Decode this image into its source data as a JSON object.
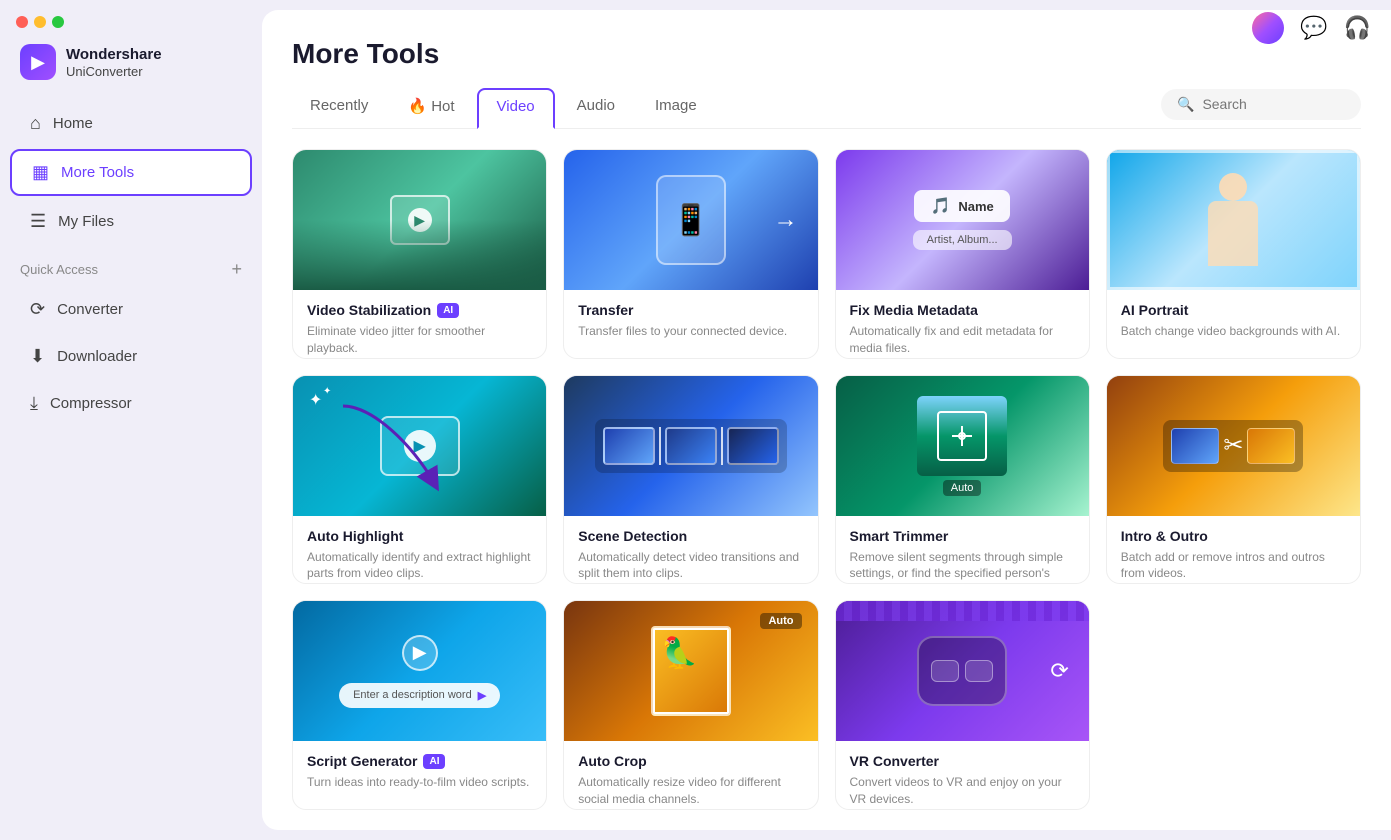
{
  "app": {
    "name": "Wondershare",
    "product": "UniConverter"
  },
  "windowControls": {
    "close": "close",
    "minimize": "minimize",
    "maximize": "maximize"
  },
  "sidebar": {
    "nav": [
      {
        "id": "home",
        "label": "Home",
        "icon": "⌂"
      },
      {
        "id": "more-tools",
        "label": "More Tools",
        "icon": "▦",
        "active": true
      },
      {
        "id": "my-files",
        "label": "My Files",
        "icon": "☰"
      }
    ],
    "quickAccess": {
      "label": "Quick Access",
      "items": [
        {
          "id": "converter",
          "label": "Converter",
          "icon": "⟳"
        },
        {
          "id": "downloader",
          "label": "Downloader",
          "icon": "⬇"
        },
        {
          "id": "compressor",
          "label": "Compressor",
          "icon": "⤓"
        }
      ]
    }
  },
  "header": {
    "title": "More Tools",
    "tabs": [
      {
        "id": "recently",
        "label": "Recently"
      },
      {
        "id": "hot",
        "label": "🔥 Hot"
      },
      {
        "id": "video",
        "label": "Video",
        "active": true
      },
      {
        "id": "audio",
        "label": "Audio"
      },
      {
        "id": "image",
        "label": "Image"
      }
    ],
    "search": {
      "placeholder": "Search"
    }
  },
  "tools": [
    {
      "id": "video-stabilization",
      "title": "Video Stabilization",
      "hasAI": true,
      "desc": "Eliminate video jitter for smoother playback.",
      "imgType": "stabilization"
    },
    {
      "id": "transfer",
      "title": "Transfer",
      "hasAI": false,
      "desc": "Transfer files to your connected device.",
      "imgType": "transfer"
    },
    {
      "id": "fix-media-metadata",
      "title": "Fix Media Metadata",
      "hasAI": false,
      "desc": "Automatically fix and edit metadata for media files.",
      "imgType": "metadata"
    },
    {
      "id": "ai-portrait",
      "title": "AI Portrait",
      "hasAI": false,
      "desc": "Batch change video backgrounds with AI.",
      "imgType": "portrait"
    },
    {
      "id": "auto-highlight",
      "title": "Auto Highlight",
      "hasAI": false,
      "desc": "Automatically identify and extract highlight parts from video clips.",
      "imgType": "autohighlight"
    },
    {
      "id": "scene-detection",
      "title": "Scene Detection",
      "hasAI": false,
      "desc": "Automatically detect video transitions and split them into clips.",
      "imgType": "scene"
    },
    {
      "id": "smart-trimmer",
      "title": "Smart Trimmer",
      "hasAI": false,
      "desc": "Remove silent segments through simple settings, or find the specified person's clips in the video.",
      "imgType": "trimmer"
    },
    {
      "id": "intro-outro",
      "title": "Intro & Outro",
      "hasAI": false,
      "desc": "Batch add or remove intros and outros from videos.",
      "imgType": "intro"
    },
    {
      "id": "script-generator",
      "title": "Script Generator",
      "hasAI": true,
      "desc": "Turn ideas into ready-to-film video scripts.",
      "imgType": "script",
      "placeholder": "Enter a description word"
    },
    {
      "id": "auto-crop",
      "title": "Auto Crop",
      "hasAI": false,
      "desc": "Automatically resize video for different social media channels.",
      "imgType": "crop"
    },
    {
      "id": "vr-converter",
      "title": "VR Converter",
      "hasAI": false,
      "desc": "Convert videos to VR and enjoy on your VR devices.",
      "imgType": "vr"
    }
  ]
}
